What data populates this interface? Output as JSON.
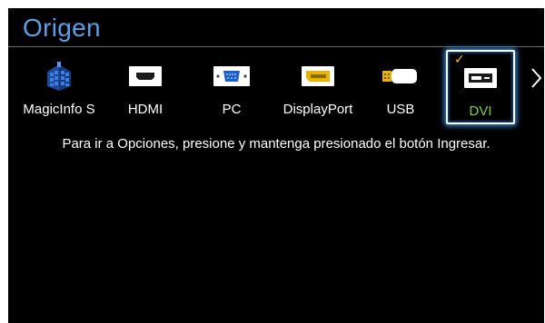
{
  "screen": {
    "title": "Origen",
    "message": "Para ir a Opciones, presione y mantenga presionado el botón Ingresar."
  },
  "sources": [
    {
      "label": "MagicInfo S",
      "icon": "magicinfo-icon",
      "selected": false
    },
    {
      "label": "HDMI",
      "icon": "hdmi-port-icon",
      "selected": false
    },
    {
      "label": "PC",
      "icon": "vga-port-icon",
      "selected": false
    },
    {
      "label": "DisplayPort",
      "icon": "displayport-icon",
      "selected": false
    },
    {
      "label": "USB",
      "icon": "usb-icon",
      "selected": false
    },
    {
      "label": "DVI",
      "icon": "dvi-port-icon",
      "selected": true
    }
  ],
  "selected_mark": "✓",
  "colors": {
    "title": "#5aa0e6",
    "selected_label": "#78d23a",
    "check_mark": "#f2c21a",
    "selection_glow": "#3b88d8"
  }
}
